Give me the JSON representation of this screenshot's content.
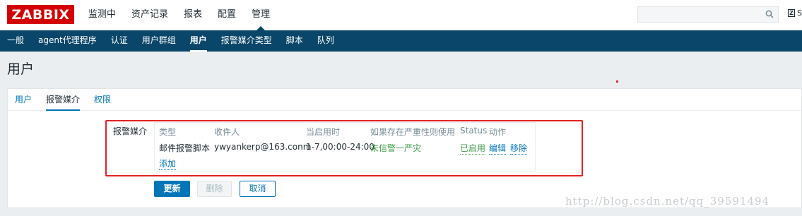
{
  "brand": {
    "logo": "ZABBIX",
    "color": "#d40000"
  },
  "main_nav": {
    "items": [
      {
        "label": "监测中"
      },
      {
        "label": "资产记录"
      },
      {
        "label": "报表"
      },
      {
        "label": "配置"
      },
      {
        "label": "管理",
        "active": true
      }
    ]
  },
  "search": {
    "placeholder": "",
    "icon": "search-icon"
  },
  "share": {
    "icon": "share-icon",
    "label": "S"
  },
  "sub_nav": {
    "items": [
      {
        "label": "一般"
      },
      {
        "label": "agent代理程序"
      },
      {
        "label": "认证"
      },
      {
        "label": "用户群组"
      },
      {
        "label": "用户",
        "active": true
      },
      {
        "label": "报警媒介类型"
      },
      {
        "label": "脚本"
      },
      {
        "label": "队列"
      }
    ]
  },
  "page": {
    "title": "用户"
  },
  "tabs": [
    {
      "label": "用户"
    },
    {
      "label": "报警媒介",
      "active": true
    },
    {
      "label": "权限"
    }
  ],
  "media_form": {
    "label": "报警媒介",
    "columns": [
      "类型",
      "收件人",
      "当启用时",
      "如果存在严重性则使用",
      "Status",
      "动作"
    ],
    "rows": [
      {
        "type": "邮件报警脚本",
        "recipient": "ywyankerp@163.conm",
        "when_active": "1-7,00:00-24:00",
        "severity": "未信警一严灾",
        "status": "已启用",
        "edit": "编辑",
        "remove": "移除"
      }
    ],
    "add_label": "添加"
  },
  "buttons": {
    "update": "更新",
    "delete": "删除",
    "cancel": "取消"
  },
  "watermark": "http://blog.csdn.net/qq_39591494",
  "colors": {
    "nav_bg": "#0a466a",
    "link": "#0275b8",
    "enabled": "#429e47",
    "highlight": "#e32222"
  }
}
